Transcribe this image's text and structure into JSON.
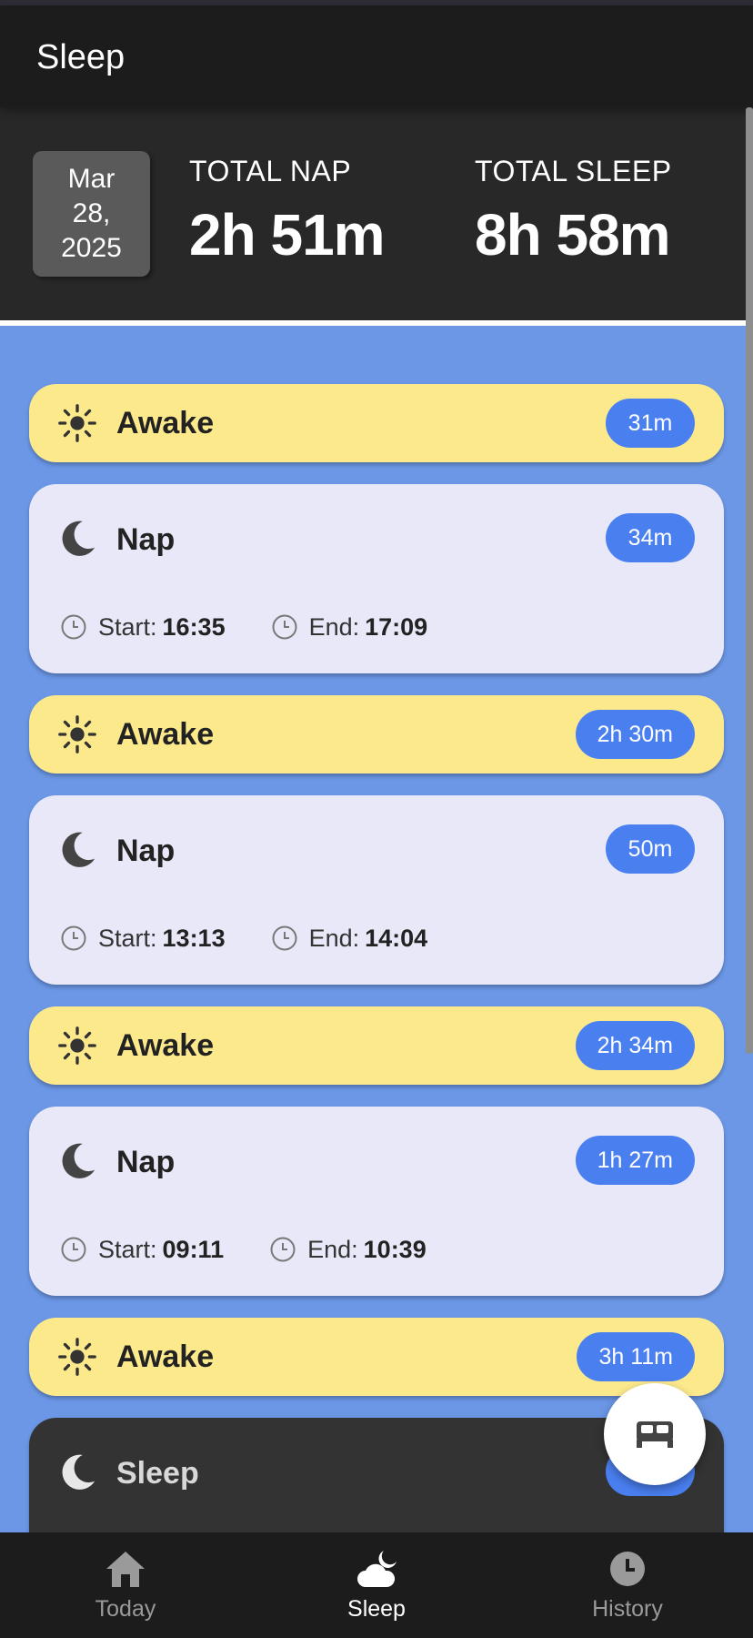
{
  "app": {
    "title": "Sleep"
  },
  "summary": {
    "date": {
      "month": "Mar",
      "day": "28,",
      "year": "2025"
    },
    "total_nap_label": "TOTAL NAP",
    "total_nap_value": "2h 51m",
    "total_sleep_label": "TOTAL SLEEP",
    "total_sleep_value": "8h 58m"
  },
  "entries": [
    {
      "type": "Awake",
      "duration": "31m",
      "icon": "sun-icon"
    },
    {
      "type": "Nap",
      "duration": "34m",
      "icon": "moon-icon",
      "start_label": "Start:",
      "start": "16:35",
      "end_label": "End:",
      "end": "17:09"
    },
    {
      "type": "Awake",
      "duration": "2h 30m",
      "icon": "sun-icon"
    },
    {
      "type": "Nap",
      "duration": "50m",
      "icon": "moon-icon",
      "start_label": "Start:",
      "start": "13:13",
      "end_label": "End:",
      "end": "14:04"
    },
    {
      "type": "Awake",
      "duration": "2h 34m",
      "icon": "sun-icon"
    },
    {
      "type": "Nap",
      "duration": "1h 27m",
      "icon": "moon-icon",
      "start_label": "Start:",
      "start": "09:11",
      "end_label": "End:",
      "end": "10:39"
    },
    {
      "type": "Awake",
      "duration": "3h 11m",
      "icon": "sun-icon"
    },
    {
      "type": "Sleep",
      "duration": "",
      "icon": "moon-icon"
    }
  ],
  "fab": {
    "icon": "bed-icon"
  },
  "nav": [
    {
      "label": "Today",
      "icon": "home-icon",
      "active": false
    },
    {
      "label": "Sleep",
      "icon": "cloud-moon-icon",
      "active": true
    },
    {
      "label": "History",
      "icon": "clock-icon",
      "active": false
    }
  ],
  "colors": {
    "background": "#6b97e6",
    "awake_card": "#fce98c",
    "nap_card": "#e8e8f8",
    "sleep_card": "#333333",
    "pill": "#4a7ff0",
    "bar": "#1c1c1c"
  }
}
